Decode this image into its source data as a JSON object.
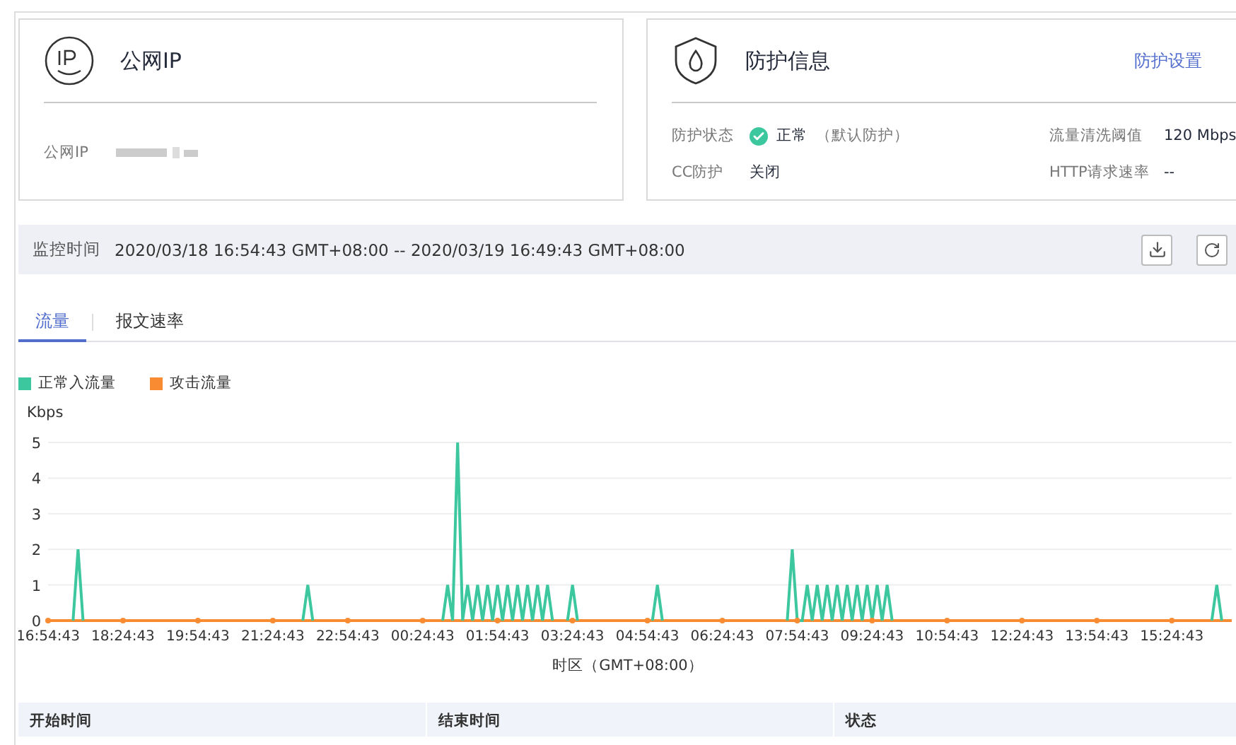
{
  "ip_card": {
    "title": "公网IP",
    "fields": [
      {
        "label": "公网IP"
      }
    ]
  },
  "protection_card": {
    "title": "防护信息",
    "link": "防护设置",
    "fields": [
      {
        "label": "防护状态",
        "ok": true,
        "value": "正常",
        "note": "（默认防护）"
      },
      {
        "label": "流量清洗阈值",
        "value": "120 Mbps"
      },
      {
        "label": "CC防护",
        "value": "关闭"
      },
      {
        "label": "HTTP请求速率",
        "value": "--"
      }
    ]
  },
  "monitor": {
    "label": "监控时间",
    "value": "2020/03/18 16:54:43 GMT+08:00 -- 2020/03/19 16:49:43 GMT+08:00"
  },
  "tabs": [
    {
      "label": "流量",
      "selected": true
    },
    {
      "label": "报文速率",
      "selected": false
    }
  ],
  "chart": {
    "chart_data": {
      "type": "line",
      "grid": true,
      "ylabel": "Kbps",
      "xlabel": "时区（GMT+08:00）",
      "ylim": [
        0,
        5
      ],
      "yticks": [
        0,
        1,
        2,
        3,
        4,
        5
      ],
      "categories": [
        "16:54:43",
        null,
        null,
        null,
        null,
        null,
        null,
        null,
        null,
        null,
        null,
        null,
        null,
        null,
        null,
        "18:24:43",
        null,
        null,
        null,
        null,
        null,
        null,
        null,
        null,
        null,
        null,
        null,
        null,
        null,
        null,
        "19:54:43",
        null,
        null,
        null,
        null,
        null,
        null,
        null,
        null,
        null,
        null,
        null,
        null,
        null,
        null,
        "21:24:43",
        null,
        null,
        null,
        null,
        null,
        null,
        null,
        null,
        null,
        null,
        null,
        null,
        null,
        null,
        "22:54:43",
        null,
        null,
        null,
        null,
        null,
        null,
        null,
        null,
        null,
        null,
        null,
        null,
        null,
        null,
        "00:24:43",
        null,
        null,
        null,
        null,
        null,
        null,
        null,
        null,
        null,
        null,
        null,
        null,
        null,
        null,
        "01:54:43",
        null,
        null,
        null,
        null,
        null,
        null,
        null,
        null,
        null,
        null,
        null,
        null,
        null,
        null,
        "03:24:43",
        null,
        null,
        null,
        null,
        null,
        null,
        null,
        null,
        null,
        null,
        null,
        null,
        null,
        null,
        "04:54:43",
        null,
        null,
        null,
        null,
        null,
        null,
        null,
        null,
        null,
        null,
        null,
        null,
        null,
        null,
        "06:24:43",
        null,
        null,
        null,
        null,
        null,
        null,
        null,
        null,
        null,
        null,
        null,
        null,
        null,
        null,
        "07:54:43",
        null,
        null,
        null,
        null,
        null,
        null,
        null,
        null,
        null,
        null,
        null,
        null,
        null,
        null,
        "09:24:43",
        null,
        null,
        null,
        null,
        null,
        null,
        null,
        null,
        null,
        null,
        null,
        null,
        null,
        null,
        "10:54:43",
        null,
        null,
        null,
        null,
        null,
        null,
        null,
        null,
        null,
        null,
        null,
        null,
        null,
        null,
        "12:24:43",
        null,
        null,
        null,
        null,
        null,
        null,
        null,
        null,
        null,
        null,
        null,
        null,
        null,
        null,
        "13:54:43",
        null,
        null,
        null,
        null,
        null,
        null,
        null,
        null,
        null,
        null,
        null,
        null,
        null,
        null,
        "15:24:43",
        null,
        null,
        null,
        null,
        null,
        null,
        null,
        null,
        null,
        null,
        null,
        null
      ],
      "series": [
        {
          "name": "正常入流量",
          "color": "#3cc79f",
          "values": [
            null,
            null,
            null,
            null,
            null,
            0,
            2,
            0,
            null,
            null,
            null,
            null,
            null,
            null,
            null,
            null,
            null,
            null,
            null,
            null,
            null,
            null,
            null,
            null,
            null,
            null,
            null,
            null,
            null,
            null,
            null,
            null,
            null,
            null,
            null,
            null,
            null,
            null,
            null,
            null,
            null,
            null,
            null,
            null,
            null,
            null,
            null,
            null,
            null,
            null,
            null,
            0,
            1,
            0,
            null,
            null,
            null,
            null,
            null,
            null,
            null,
            null,
            null,
            null,
            null,
            null,
            null,
            null,
            null,
            null,
            null,
            null,
            null,
            null,
            null,
            null,
            null,
            null,
            null,
            0,
            1,
            0,
            5,
            0,
            1,
            0,
            1,
            0,
            1,
            0,
            1,
            0,
            1,
            0,
            1,
            0,
            1,
            0,
            1,
            0,
            1,
            0,
            null,
            null,
            0,
            1,
            0,
            null,
            null,
            null,
            null,
            null,
            null,
            null,
            null,
            null,
            null,
            null,
            null,
            null,
            null,
            0,
            1,
            0,
            null,
            null,
            null,
            null,
            null,
            null,
            null,
            null,
            null,
            null,
            null,
            null,
            null,
            null,
            null,
            null,
            null,
            null,
            null,
            null,
            null,
            null,
            null,
            null,
            0,
            2,
            0,
            0,
            1,
            0,
            1,
            0,
            1,
            0,
            1,
            0,
            1,
            0,
            1,
            0,
            1,
            0,
            1,
            0,
            1,
            0,
            null,
            null,
            null,
            null,
            null,
            null,
            null,
            null,
            null,
            null,
            null,
            null,
            null,
            null,
            null,
            null,
            null,
            null,
            null,
            null,
            null,
            null,
            null,
            null,
            null,
            null,
            null,
            null,
            null,
            null,
            null,
            null,
            null,
            null,
            null,
            null,
            null,
            null,
            null,
            null,
            null,
            null,
            null,
            null,
            null,
            null,
            null,
            null,
            null,
            null,
            null,
            null,
            null,
            null,
            null,
            null,
            null,
            null,
            null,
            null,
            null,
            null,
            null,
            0,
            1,
            0,
            null,
            null
          ]
        },
        {
          "name": "攻击流量",
          "color": "#f98c33",
          "values": [
            0,
            0,
            0,
            0,
            0,
            0,
            0,
            0,
            0,
            0,
            0,
            0,
            0,
            0,
            0,
            0,
            0,
            0,
            0,
            0,
            0,
            0,
            0,
            0,
            0,
            0,
            0,
            0,
            0,
            0,
            0,
            0,
            0,
            0,
            0,
            0,
            0,
            0,
            0,
            0,
            0,
            0,
            0,
            0,
            0,
            0,
            0,
            0,
            0,
            0,
            0,
            0,
            0,
            0,
            0,
            0,
            0,
            0,
            0,
            0,
            0,
            0,
            0,
            0,
            0,
            0,
            0,
            0,
            0,
            0,
            0,
            0,
            0,
            0,
            0,
            0,
            0,
            0,
            0,
            0,
            0,
            0,
            0,
            0,
            0,
            0,
            0,
            0,
            0,
            0,
            0,
            0,
            0,
            0,
            0,
            0,
            0,
            0,
            0,
            0,
            0,
            0,
            0,
            0,
            0,
            0,
            0,
            0,
            0,
            0,
            0,
            0,
            0,
            0,
            0,
            0,
            0,
            0,
            0,
            0,
            0,
            0,
            0,
            0,
            0,
            0,
            0,
            0,
            0,
            0,
            0,
            0,
            0,
            0,
            0,
            0,
            0,
            0,
            0,
            0,
            0,
            0,
            0,
            0,
            0,
            0,
            0,
            0,
            0,
            0,
            0,
            0,
            0,
            0,
            0,
            0,
            0,
            0,
            0,
            0,
            0,
            0,
            0,
            0,
            0,
            0,
            0,
            0,
            0,
            0,
            0,
            0,
            0,
            0,
            0,
            0,
            0,
            0,
            0,
            0,
            0,
            0,
            0,
            0,
            0,
            0,
            0,
            0,
            0,
            0,
            0,
            0,
            0,
            0,
            0,
            0,
            0,
            0,
            0,
            0,
            0,
            0,
            0,
            0,
            0,
            0,
            0,
            0,
            0,
            0,
            0,
            0,
            0,
            0,
            0,
            0,
            0,
            0,
            0,
            0,
            0,
            0,
            0,
            0,
            0,
            0,
            0,
            0,
            0,
            0,
            0,
            0,
            0,
            0,
            0,
            0,
            0,
            0
          ]
        }
      ]
    }
  },
  "table": {
    "columns": [
      "开始时间",
      "结束时间",
      "状态"
    ]
  }
}
